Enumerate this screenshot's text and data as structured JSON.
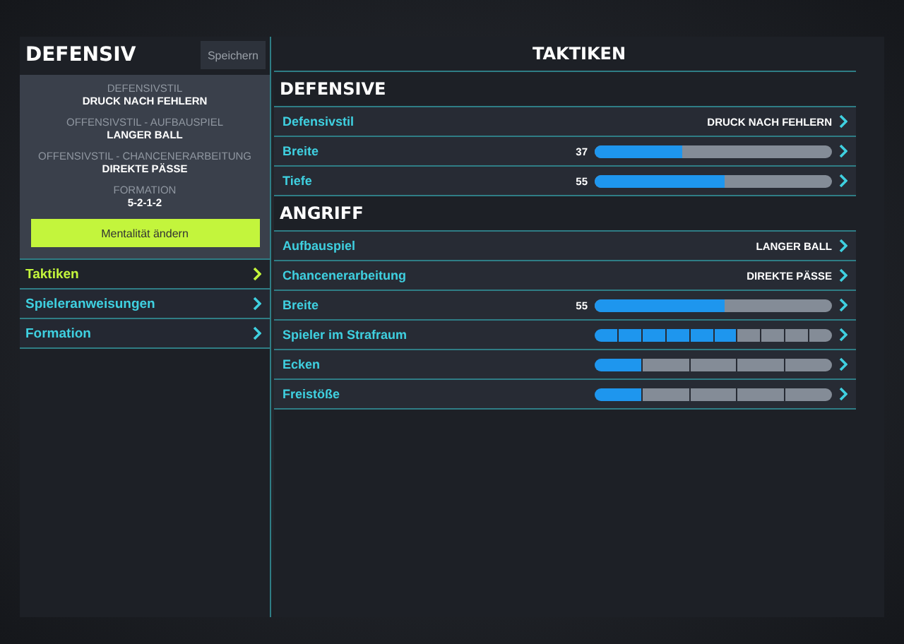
{
  "left_panel": {
    "title": "DEFENSIV",
    "save_button": "Speichern",
    "summary": [
      {
        "label": "DEFENSIVSTIL",
        "value": "DRUCK NACH FEHLERN"
      },
      {
        "label": "OFFENSIVSTIL - AUFBAUSPIEL",
        "value": "LANGER BALL"
      },
      {
        "label": "OFFENSIVSTIL - CHANCENERARBEITUNG",
        "value": "DIREKTE PÄSSE"
      },
      {
        "label": "FORMATION",
        "value": "5-2-1-2"
      }
    ],
    "mentality_button": "Mentalität ändern",
    "nav": [
      {
        "label": "Taktiken",
        "selected": true
      },
      {
        "label": "Spieleranweisungen",
        "selected": false
      },
      {
        "label": "Formation",
        "selected": false
      }
    ]
  },
  "right_panel": {
    "title": "TAKTIKEN",
    "sections": [
      {
        "heading": "DEFENSIVE",
        "rows": [
          {
            "kind": "choice",
            "label": "Defensivstil",
            "value": "DRUCK NACH FEHLERN"
          },
          {
            "kind": "slider",
            "label": "Breite",
            "reading": "37",
            "level": 0.37
          },
          {
            "kind": "slider",
            "label": "Tiefe",
            "reading": "55",
            "level": 0.55
          }
        ]
      },
      {
        "heading": "ANGRIFF",
        "rows": [
          {
            "kind": "choice",
            "label": "Aufbauspiel",
            "value": "LANGER BALL"
          },
          {
            "kind": "choice",
            "label": "Chancenerarbeitung",
            "value": "DIREKTE PÄSSE"
          },
          {
            "kind": "slider",
            "label": "Breite",
            "reading": "55",
            "level": 0.55
          },
          {
            "kind": "steps",
            "label": "Spieler im Strafraum",
            "segments": [
              {
                "on": true
              },
              {
                "on": true
              },
              {
                "on": true
              },
              {
                "on": true
              },
              {
                "on": true
              },
              {
                "on": true
              },
              {
                "on": false
              },
              {
                "on": false
              },
              {
                "on": false
              },
              {
                "on": false
              }
            ]
          },
          {
            "kind": "steps",
            "label": "Ecken",
            "segments": [
              {
                "on": true
              },
              {
                "on": false
              },
              {
                "on": false
              },
              {
                "on": false
              },
              {
                "on": false
              }
            ]
          },
          {
            "kind": "steps",
            "label": "Freistöße",
            "segments": [
              {
                "on": true
              },
              {
                "on": false
              },
              {
                "on": false
              },
              {
                "on": false
              },
              {
                "on": false
              }
            ]
          }
        ]
      }
    ]
  }
}
